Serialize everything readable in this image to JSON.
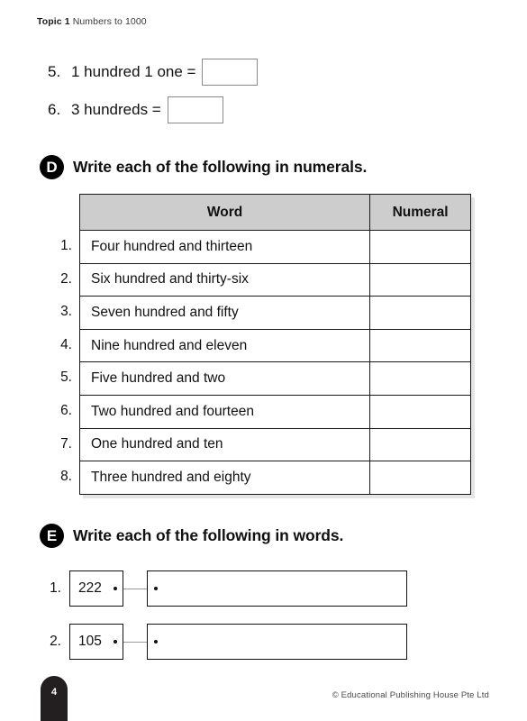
{
  "header": {
    "topic_label": "Topic 1",
    "topic_title": "Numbers to 1000"
  },
  "carryover_questions": [
    {
      "number": "5.",
      "text": "1 hundred 1 one =",
      "answer": ""
    },
    {
      "number": "6.",
      "text": "3 hundreds =",
      "answer": ""
    }
  ],
  "section_d": {
    "badge": "D",
    "title": "Write each of the following in numerals.",
    "columns": [
      "Word",
      "Numeral"
    ],
    "rows": [
      {
        "number": "1.",
        "word": "Four hundred and thirteen",
        "numeral": ""
      },
      {
        "number": "2.",
        "word": "Six hundred and thirty-six",
        "numeral": ""
      },
      {
        "number": "3.",
        "word": "Seven hundred and fifty",
        "numeral": ""
      },
      {
        "number": "4.",
        "word": "Nine hundred and eleven",
        "numeral": ""
      },
      {
        "number": "5.",
        "word": "Five hundred and two",
        "numeral": ""
      },
      {
        "number": "6.",
        "word": "Two hundred and fourteen",
        "numeral": ""
      },
      {
        "number": "7.",
        "word": "One hundred and ten",
        "numeral": ""
      },
      {
        "number": "8.",
        "word": "Three hundred and eighty",
        "numeral": ""
      }
    ]
  },
  "section_e": {
    "badge": "E",
    "title": "Write each of the following in words.",
    "rows": [
      {
        "number": "1.",
        "value": "222",
        "answer": ""
      },
      {
        "number": "2.",
        "value": "105",
        "answer": ""
      }
    ]
  },
  "footer": {
    "page_number": "4",
    "copyright": "© Educational Publishing House Pte Ltd"
  },
  "colors": {
    "ink": "#111111",
    "table_header_fill": "#cdcdcd",
    "badge_fill": "#000000",
    "page_tab_fill": "#231f20",
    "field_border": "#8a8a8a"
  }
}
